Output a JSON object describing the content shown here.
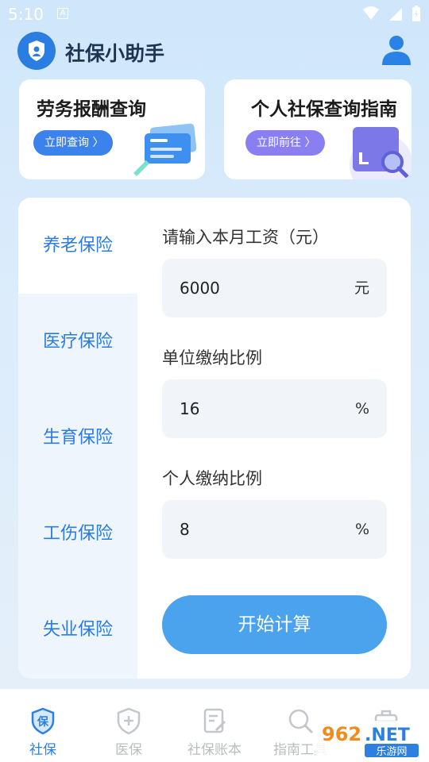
{
  "status": {
    "time": "5:10",
    "notification": "A"
  },
  "header": {
    "title": "社保小助手"
  },
  "cards": [
    {
      "title": "劳务报酬查询",
      "button": "立即查询 〉"
    },
    {
      "title": "个人社保查询指南",
      "button": "立即前往 〉"
    }
  ],
  "sidebar": {
    "items": [
      {
        "label": "养老保险"
      },
      {
        "label": "医疗保险"
      },
      {
        "label": "生育保险"
      },
      {
        "label": "工伤保险"
      },
      {
        "label": "失业保险"
      }
    ]
  },
  "form": {
    "salary_label": "请输入本月工资（元）",
    "salary_value": "6000",
    "salary_unit": "元",
    "company_label": "单位缴纳比例",
    "company_value": "16",
    "company_unit": "%",
    "personal_label": "个人缴纳比例",
    "personal_value": "8",
    "personal_unit": "%",
    "submit": "开始计算"
  },
  "tabs": [
    {
      "label": "社保",
      "icon": "shield-badge-icon",
      "active": true
    },
    {
      "label": "医保",
      "icon": "shield-plus-icon"
    },
    {
      "label": "社保账本",
      "icon": "notebook-pen-icon"
    },
    {
      "label": "指南工具",
      "icon": "search-icon"
    },
    {
      "label": "",
      "icon": "toolbox-icon"
    }
  ],
  "watermark": {
    "text": "962.NET",
    "subtext": "乐游网"
  },
  "colors": {
    "primary": "#2d7fe0",
    "button": "#4aa3ec",
    "pill_blue": "#3c82ec",
    "pill_purple": "#8a7ff0",
    "sidebar_bg": "#eef5fd"
  }
}
